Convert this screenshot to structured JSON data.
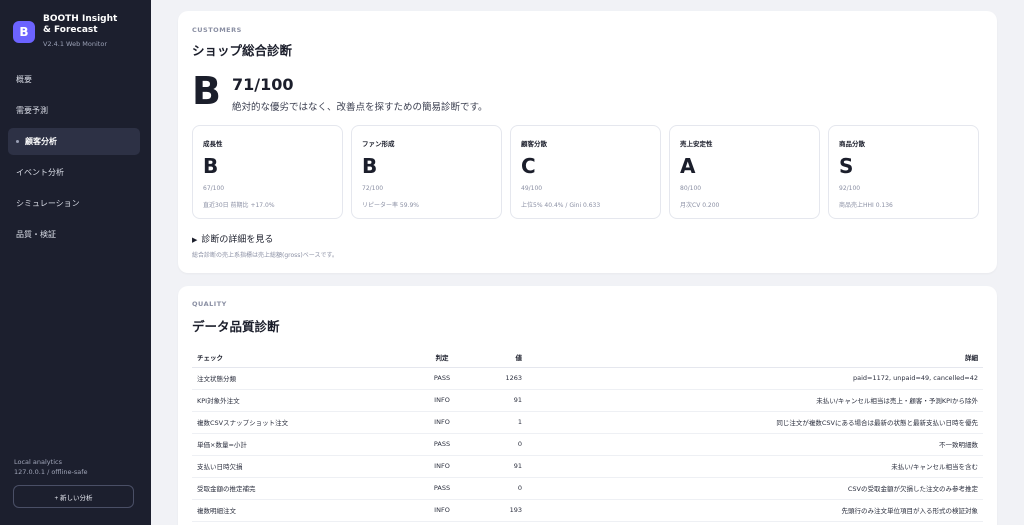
{
  "app": {
    "logo_letter": "B",
    "title": "BOOTH Insight & Forecast",
    "version": "V2.4.1 Web Monitor",
    "accent_color": "#6c63ff"
  },
  "nav": [
    {
      "label": "概要",
      "active": false
    },
    {
      "label": "需要予測",
      "active": false
    },
    {
      "label": "顧客分析",
      "active": true
    },
    {
      "label": "イベント分析",
      "active": false
    },
    {
      "label": "シミュレーション",
      "active": false
    },
    {
      "label": "品質・検証",
      "active": false
    }
  ],
  "footer": {
    "line1": "Local analytics",
    "line2": "127.0.0.1 / offline-safe",
    "new_button": "+ 新しい分析"
  },
  "customers": {
    "section_label": "CUSTOMERS",
    "title": "ショップ総合診断",
    "grade": "B",
    "score": "71/100",
    "description": "絶対的な優劣ではなく、改善点を探すための簡易診断です。",
    "metrics": [
      {
        "label": "成長性",
        "grade": "B",
        "score": "67/100",
        "detail": "直近30日 前期比 +17.0%"
      },
      {
        "label": "ファン形成",
        "grade": "B",
        "score": "72/100",
        "detail": "リピーター率 59.9%"
      },
      {
        "label": "顧客分散",
        "grade": "C",
        "score": "49/100",
        "detail": "上位5% 40.4% / Gini 0.633"
      },
      {
        "label": "売上安定性",
        "grade": "A",
        "score": "80/100",
        "detail": "月次CV 0.200"
      },
      {
        "label": "商品分散",
        "grade": "S",
        "score": "92/100",
        "detail": "商品売上HHI 0.136"
      }
    ],
    "details_toggle": "診断の詳細を見る",
    "footnote": "総合診断の売上系指標は売上総額(gross)ベースです。"
  },
  "quality": {
    "section_label": "QUALITY",
    "title": "データ品質診断",
    "columns": [
      "チェック",
      "判定",
      "値",
      "詳細"
    ],
    "rows": [
      {
        "check": "注文状態分類",
        "judge": "PASS",
        "value": "1263",
        "detail": "paid=1172, unpaid=49, cancelled=42"
      },
      {
        "check": "KPI対象外注文",
        "judge": "INFO",
        "value": "91",
        "detail": "未払い/キャンセル相当は売上・顧客・予測KPIから除外"
      },
      {
        "check": "複数CSVスナップショット注文",
        "judge": "INFO",
        "value": "1",
        "detail": "同じ注文が複数CSVにある場合は最新の状態と最新支払い日時を優先"
      },
      {
        "check": "単価×数量=小計",
        "judge": "PASS",
        "value": "0",
        "detail": "不一致明細数"
      },
      {
        "check": "支払い日時欠損",
        "judge": "INFO",
        "value": "91",
        "detail": "未払い/キャンセル相当を含む"
      },
      {
        "check": "受取金額の推定補完",
        "judge": "PASS",
        "value": "0",
        "detail": "CSVの受取金額が欠損した注文のみ参考推定"
      },
      {
        "check": "複数明細注文",
        "judge": "INFO",
        "value": "193",
        "detail": "先頭行のみ注文単位項目が入る形式の検証対象"
      }
    ]
  }
}
